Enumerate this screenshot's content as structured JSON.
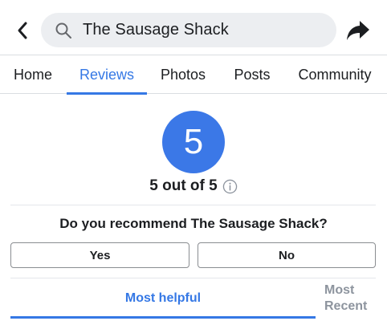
{
  "header": {
    "back_icon": "chevron-left-icon",
    "search_icon": "search-icon",
    "search_value": "The Sausage Shack",
    "share_icon": "share-arrow-icon"
  },
  "tabs": [
    {
      "label": "Home",
      "active": false
    },
    {
      "label": "Reviews",
      "active": true
    },
    {
      "label": "Photos",
      "active": false
    },
    {
      "label": "Posts",
      "active": false
    },
    {
      "label": "Community",
      "active": false
    }
  ],
  "rating": {
    "value": "5",
    "summary": "5 out of 5",
    "info_icon": "info-icon"
  },
  "recommend": {
    "question": "Do you recommend The Sausage Shack?",
    "yes_label": "Yes",
    "no_label": "No"
  },
  "sort": {
    "helpful_label": "Most helpful",
    "recent_label_line1": "Most",
    "recent_label_line2": "Recent",
    "active": "helpful"
  },
  "colors": {
    "accent": "#3578e5",
    "rating_circle": "#3b78e7",
    "search_bg": "#eceef1",
    "muted_text": "#8d949e"
  }
}
